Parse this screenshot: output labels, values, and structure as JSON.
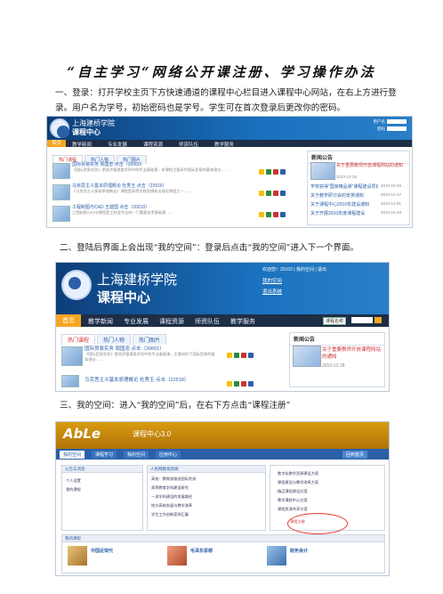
{
  "document": {
    "title": "“自主学习“网络公开课注册、学习操作办法",
    "para1": "一、登录：打开学校主页下方快速通道的课程中心栏目进入课程中心网站，在右上方进行登录。用户名为学号，初始密码也是学号。学生可在首次登录后更改你的密码。",
    "para2": "二、登陆后界面上会出现“我的空间”：登录后点击“我的空间”进入下一个界面。",
    "para3": "三、我的空间：进入“我的空间”后，在右下方点击“课程注册”"
  },
  "screenshot1": {
    "school": "上海建桥学院",
    "subtitle": "课程中心",
    "nav": [
      "首页",
      "教学新闻",
      "专业发展",
      "课程资源",
      "师资队伍",
      "教学服务"
    ],
    "tabs": [
      "热门课程",
      "热门人物",
      "热门图片"
    ],
    "rows": [
      {
        "title": "国际贸易实务  周国忠  点击（20060）",
        "text": "《国际贸易实务》是经济管理类学科中的专业基础课，本课程主要研究国际贸易的基本理论……"
      },
      {
        "title": "马克思主义基本原理概论  杜秀玉  点击（22516）",
        "text": "《马克思主义基本原理概论》课程是高等学校思想政治理论课程之一……"
      },
      {
        "title": "工程制图与CAD  王建国  点击（20210）",
        "text": "工程制图与CAD课程是工科类专业的一门重要技术基础课……"
      }
    ],
    "news_header": "新闻公告",
    "news_items": [
      {
        "text": "关于重要教师开放课程网站的通知",
        "date": "2010-12-28"
      },
      {
        "text": "学校获得“国家精品课”课程建设项目",
        "date": "2010-10-29"
      },
      {
        "text": "关于教学研讨会的安排通知",
        "date": "2010-12-17"
      },
      {
        "text": "关于课程中心2010年建设通知",
        "date": "2010-12-01"
      },
      {
        "text": "关于开展2010年度课程建设",
        "date": "2010-10-18"
      }
    ],
    "login": {
      "user_label": "用户名",
      "pwd_label": "密码"
    }
  },
  "screenshot2": {
    "school": "上海建桥学院",
    "subtitle": "课程中心",
    "top_links": "欢迎您！20102  |  我的空间  |  退出",
    "space_link": "我的空间",
    "logout_link": "退出系统",
    "nav": [
      "首页",
      "教学新闻",
      "专业发展",
      "课程资源",
      "师资队伍",
      "教学服务"
    ],
    "search_select": "课程名称",
    "tabs": [
      "热门课程",
      "热门人物",
      "热门图片"
    ],
    "rows": [
      {
        "title": "国际贸易实务  周国忠  点击（20601）",
        "text": "《国际贸易实务》是经济管理类学科中的专业基础课，主要研究了国际贸易的基本理论……"
      },
      {
        "title": "马克思主义基本原理概论  杜秀玉  点击（22518）",
        "text": ""
      }
    ],
    "news_header": "新闻公告",
    "news_item": "关于重要教师开放课程网站的通知",
    "news_date": "2010-12-28"
  },
  "screenshot3": {
    "logo": "AbLe",
    "subtitle": "课程中心3.0",
    "tabs": [
      "我的空间",
      "课程学习",
      "我的空间",
      "应用中心"
    ],
    "right_btn": "回到首页",
    "left_panel_items": [
      "公告与消息",
      "个人设置",
      "我的课程"
    ],
    "mid_panel_header": "人民网教育新闻",
    "mid_items": [
      "高校：教育部推进国际交流",
      "高等教育学科建设研究",
      "一流学科建设的发展路径",
      "地方高校发展与教学改革",
      "学生工作创新案例汇编"
    ],
    "right_items": [
      "数字化教学资源建设方案",
      "课程建设与教学改革方案",
      "精品课程建设方案",
      "教学课程中心方案",
      "课程资源共享方案"
    ],
    "bottom_header": "我的课程",
    "bottom_cards": [
      "中国近现代",
      "毛泽东思想",
      "财务会计"
    ],
    "register_link": "课程注册"
  },
  "colors": {
    "banner": "#1a72bf",
    "nav": "#1e2e46",
    "home": "#f6a623",
    "able": "#d89b12",
    "circle": "#e23b2e"
  }
}
